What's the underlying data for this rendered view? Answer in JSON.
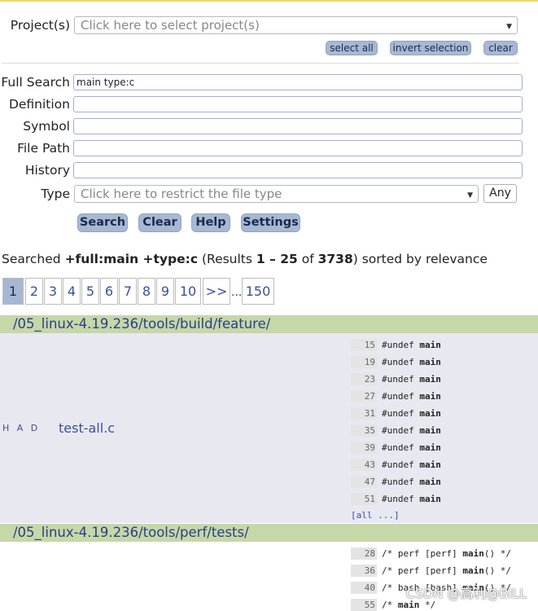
{
  "labels": {
    "projects": "Project(s)",
    "full_search": "Full Search",
    "definition": "Definition",
    "symbol": "Symbol",
    "file_path": "File Path",
    "history": "History",
    "type": "Type"
  },
  "project_select": {
    "placeholder": "Click here to select project(s)"
  },
  "project_actions": {
    "select_all": "select all",
    "invert_selection": "invert selection",
    "clear": "clear"
  },
  "fields": {
    "full_search_value": "main type:c",
    "definition_value": "",
    "symbol_value": "",
    "file_path_value": "",
    "history_value": ""
  },
  "type_select": {
    "placeholder": "Click here to restrict the file type",
    "any_label": "Any"
  },
  "buttons": {
    "search": "Search",
    "clear": "Clear",
    "help": "Help",
    "settings": "Settings"
  },
  "summary": {
    "prefix": "Searched ",
    "query": "+full:main +type:c",
    "results_open": " (Results ",
    "range": "1 – 25",
    "of": " of ",
    "total": "3738",
    "suffix": ") sorted by relevance"
  },
  "pagination": {
    "pages": [
      "1",
      "2",
      "3",
      "4",
      "5",
      "6",
      "7",
      "8",
      "9",
      "10",
      ">>"
    ],
    "ellipsis": "...",
    "last": "150",
    "active": "1"
  },
  "results": [
    {
      "directory": "/05_linux-4.19.236/tools/build/feature/",
      "badges": "H A D",
      "file": "test-all.c",
      "lines": [
        {
          "num": "15",
          "pre": "#undef ",
          "match": "main",
          "post": ""
        },
        {
          "num": "19",
          "pre": "#undef ",
          "match": "main",
          "post": ""
        },
        {
          "num": "23",
          "pre": "#undef ",
          "match": "main",
          "post": ""
        },
        {
          "num": "27",
          "pre": "#undef ",
          "match": "main",
          "post": ""
        },
        {
          "num": "31",
          "pre": "#undef ",
          "match": "main",
          "post": ""
        },
        {
          "num": "35",
          "pre": "#undef ",
          "match": "main",
          "post": ""
        },
        {
          "num": "39",
          "pre": "#undef ",
          "match": "main",
          "post": ""
        },
        {
          "num": "43",
          "pre": "#undef ",
          "match": "main",
          "post": ""
        },
        {
          "num": "47",
          "pre": "#undef ",
          "match": "main",
          "post": ""
        },
        {
          "num": "51",
          "pre": "#undef ",
          "match": "main",
          "post": ""
        }
      ],
      "more": "[all ...]"
    },
    {
      "directory": "/05_linux-4.19.236/tools/perf/tests/",
      "lines": [
        {
          "num": "28",
          "pre": "/* perf [perf] ",
          "match": "main",
          "post": "() */"
        },
        {
          "num": "36",
          "pre": "/* perf [perf] ",
          "match": "main",
          "post": "() */"
        },
        {
          "num": "40",
          "pre": "/* bash [bash] ",
          "match": "main",
          "post": "() */"
        },
        {
          "num": "55",
          "pre": "/* ",
          "match": "main",
          "post": " */"
        }
      ]
    }
  ],
  "watermark": "CSDN @高利@BILL",
  "colors": {
    "accent": "#a7b8d4",
    "dir_bar": "#c6d7a8",
    "link": "#3a4fa0",
    "result_bg": "#e8e8f0"
  }
}
